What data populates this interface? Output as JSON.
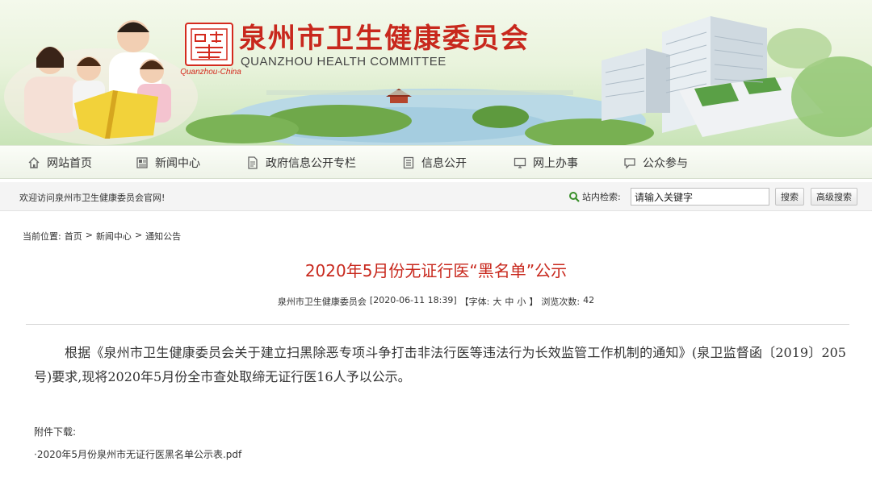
{
  "header": {
    "site_title": "泉州市卫生健康委员会",
    "site_subtitle": "QUANZHOU HEALTH COMMITTEE",
    "logo_caption": "Quanzhou-China",
    "accent_color": "#c8281d"
  },
  "nav": {
    "items": [
      {
        "label": "网站首页",
        "icon": "home-icon"
      },
      {
        "label": "新闻中心",
        "icon": "newspaper-icon"
      },
      {
        "label": "政府信息公开专栏",
        "icon": "document-icon"
      },
      {
        "label": "信息公开",
        "icon": "list-icon"
      },
      {
        "label": "网上办事",
        "icon": "monitor-icon"
      },
      {
        "label": "公众参与",
        "icon": "chat-icon"
      }
    ]
  },
  "topbar": {
    "welcome": "欢迎访问泉州市卫生健康委员会官网!",
    "search_label": "站内检索:",
    "search_value": "请输入关键字",
    "search_button": "搜索",
    "advanced_search_button": "高级搜索"
  },
  "breadcrumb": {
    "prefix": "当前位置:",
    "items": [
      "首页",
      "新闻中心",
      "通知公告"
    ],
    "separator": ">"
  },
  "article": {
    "title": "2020年5月份无证行医“黑名单”公示",
    "source": "泉州市卫生健康委员会",
    "date": "[2020-06-11 18:39]",
    "font_label": "【字体:",
    "font_sizes": [
      "大",
      "中",
      "小"
    ],
    "font_close": "】",
    "views_label": "浏览次数:",
    "views": "42",
    "body": "根据《泉州市卫生健康委员会关于建立扫黑除恶专项斗争打击非法行医等违法行为长效监管工作机制的通知》(泉卫监督函〔2019〕205号)要求,现将2020年5月份全市查处取缔无证行医16人予以公示。",
    "attachment_label": "附件下载:",
    "attachment_file": "·2020年5月份泉州市无证行医黑名单公示表.pdf"
  }
}
